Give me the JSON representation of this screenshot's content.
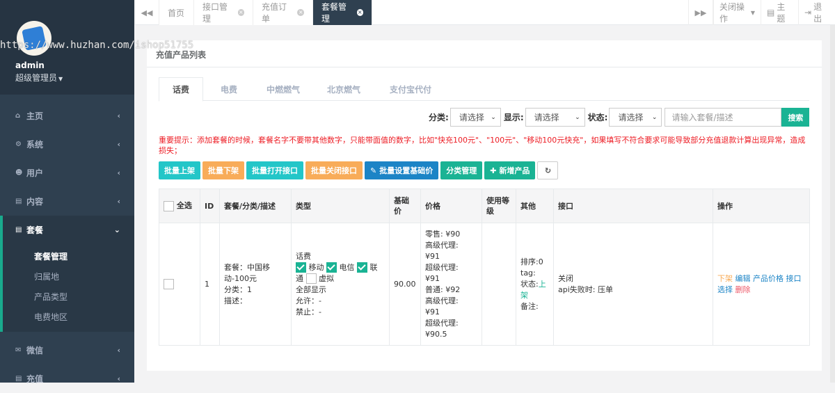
{
  "watermark": "https://www.huzhan.com/ishop51755",
  "sidebar": {
    "username": "admin",
    "role": "超级管理员",
    "items": [
      {
        "label": "主页",
        "icon": "home-icon"
      },
      {
        "label": "系统",
        "icon": "cogs-icon"
      },
      {
        "label": "用户",
        "icon": "users-icon"
      },
      {
        "label": "内容",
        "icon": "file-icon"
      },
      {
        "label": "套餐",
        "icon": "file-text-icon"
      },
      {
        "label": "微信",
        "icon": "wechat-icon"
      },
      {
        "label": "充值",
        "icon": "file-icon"
      }
    ],
    "subitems": [
      "套餐管理",
      "归属地",
      "产品类型",
      "电费地区"
    ]
  },
  "topbar": {
    "tabs": [
      "首页",
      "接口管理",
      "充值订单",
      "套餐管理"
    ],
    "close_ops": "关闭操作",
    "theme": "主题",
    "logout": "退出"
  },
  "panel": {
    "title": "充值产品列表",
    "tabs": [
      "话费",
      "电费",
      "中燃燃气",
      "北京燃气",
      "支付宝代付"
    ],
    "filters": {
      "category_label": "分类:",
      "category_value": "请选择",
      "display_label": "显示:",
      "display_value": "请选择",
      "status_label": "状态:",
      "status_value": "请选择",
      "search_placeholder": "请输入套餐/描述",
      "search_button": "搜索"
    },
    "warning": "重要提示：添加套餐的时候，套餐名字不要带其他数字，只能带面值的数字，比如\"快充100元\"、\"100元\"、\"移动100元快充\"，如果填写不符合要求可能导致部分充值退款计算出现异常，造成损失；",
    "actions": [
      "批量上架",
      "批量下架",
      "批量打开接口",
      "批量关闭接口",
      "批量设置基础价",
      "分类管理",
      "新增产品"
    ]
  },
  "table": {
    "headers": [
      "全选",
      "ID",
      "套餐/分类/描述",
      "类型",
      "基础价",
      "价格",
      "使用等级",
      "其他",
      "接口",
      "操作"
    ],
    "rows": [
      {
        "id": "1",
        "package": "套餐：中国移动-100元",
        "category": "分类：1",
        "desc": "描述：",
        "type_title": "话费",
        "type_mobile": "移动",
        "type_telecom": "电信",
        "type_unicom": "联通",
        "type_virtual": "虚拟",
        "display": "全部显示",
        "allow": "允许：-",
        "deny": "禁止：-",
        "base_price": "90.00",
        "price_lines": [
          "零售: ¥90",
          "高级代理:",
          "¥91",
          "超级代理:",
          "¥91",
          "普通: ¥92",
          "高级代理:",
          "¥91",
          "超级代理:",
          "¥90.5"
        ],
        "sort": "排序:0",
        "tag": "tag:",
        "status_label": "状态:",
        "status_value": "上架",
        "remark": "备注:",
        "api_status": "关闭",
        "api_fail": "api失败时: 压单",
        "op_down": "下架",
        "op_edit": "编辑",
        "op_price": "产品价格",
        "op_api": "接口选择",
        "op_delete": "删除"
      }
    ]
  }
}
